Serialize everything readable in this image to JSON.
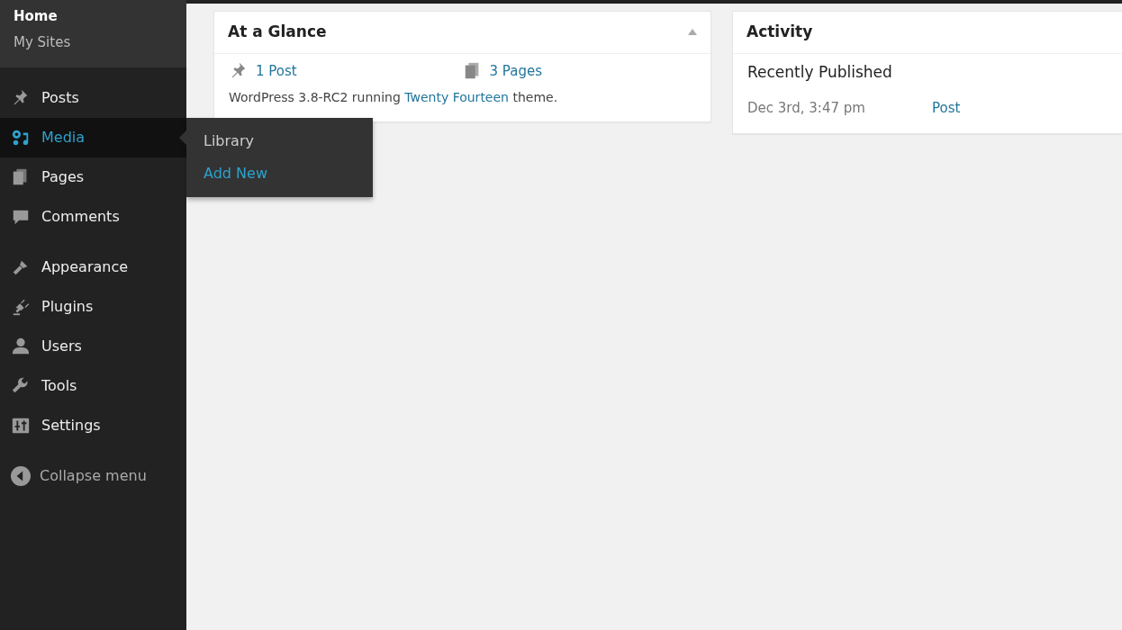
{
  "sidebar": {
    "top_links": [
      {
        "label": "Home",
        "selected": true
      },
      {
        "label": "My Sites",
        "selected": false
      }
    ],
    "items": [
      {
        "label": "Posts",
        "selected": false
      },
      {
        "label": "Media",
        "selected": true,
        "flyout": [
          {
            "label": "Library",
            "selected": false
          },
          {
            "label": "Add New",
            "selected": true
          }
        ]
      },
      {
        "label": "Pages",
        "selected": false
      },
      {
        "label": "Comments",
        "selected": false
      },
      {
        "label": "Appearance",
        "selected": false
      },
      {
        "label": "Plugins",
        "selected": false
      },
      {
        "label": "Users",
        "selected": false
      },
      {
        "label": "Tools",
        "selected": false
      },
      {
        "label": "Settings",
        "selected": false
      }
    ],
    "collapse": "Collapse menu"
  },
  "at_a_glance": {
    "title": "At a Glance",
    "expanded": true,
    "counts": [
      "1 Post",
      "3 Pages"
    ],
    "text_before": "WordPress 3.8-RC2 running",
    "theme_link": "Twenty Fourteen",
    "text_after": "theme."
  },
  "activity": {
    "title": "Activity",
    "subtitle": "Recently Published",
    "rows": [
      {
        "date": "Dec 3rd, 3:47 pm",
        "title": "Post"
      }
    ]
  }
}
